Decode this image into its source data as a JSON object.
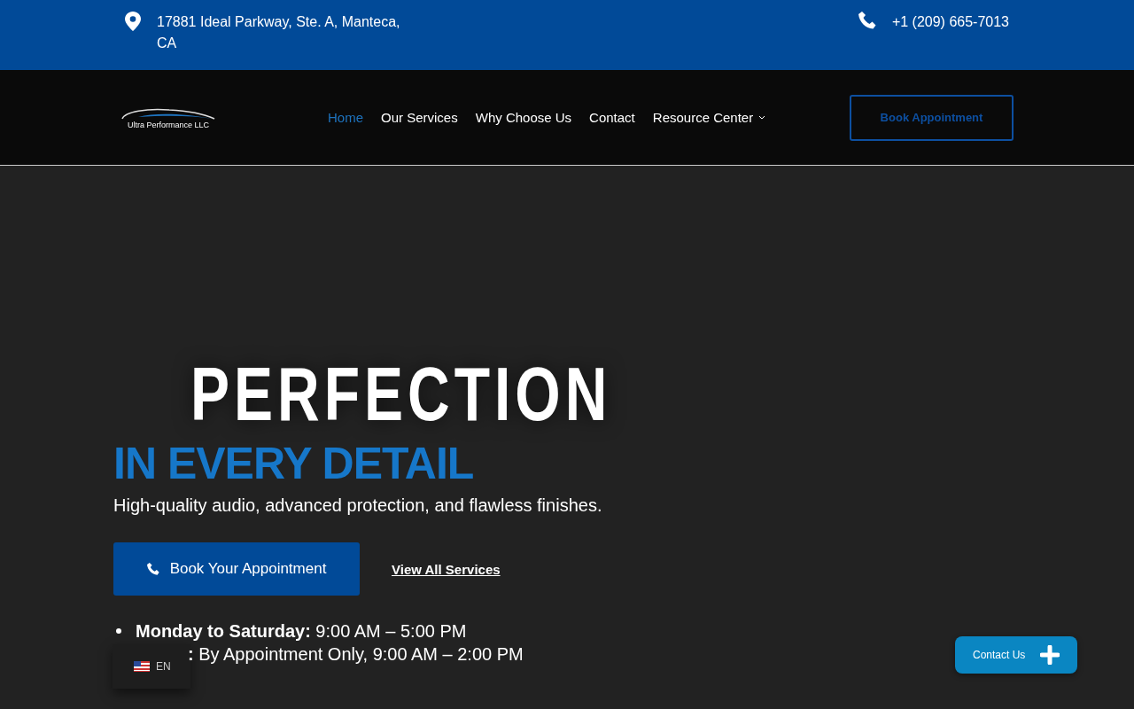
{
  "top_bar": {
    "address": "17881 Ideal Parkway, Ste. A, Manteca, CA",
    "phone": "+1 (209) 665-7013"
  },
  "header": {
    "logo_text": "Ultra Performance LLC",
    "nav": [
      {
        "label": "Home",
        "selected": true,
        "dropdown": false
      },
      {
        "label": "Our Services",
        "selected": false,
        "dropdown": false
      },
      {
        "label": "Why Choose Us",
        "selected": false,
        "dropdown": false
      },
      {
        "label": "Contact",
        "selected": false,
        "dropdown": false
      },
      {
        "label": "Resource Center",
        "selected": false,
        "dropdown": true
      }
    ],
    "cta": "Book Appointment"
  },
  "hero": {
    "title": "PERFECTION",
    "subtitle": "IN EVERY DETAIL",
    "tagline": "High-quality audio, advanced protection, and flawless finishes.",
    "primary_button": "Book Your Appointment",
    "secondary_link": "View All Services",
    "hours": [
      "**Monday to Saturday:** 9:00 AM – 5:00 PM",
      "**:** By Appointment Only, 9:00 AM – 2:00 PM"
    ]
  },
  "language": {
    "code": "EN"
  },
  "contact_widget": {
    "label": "Contact Us"
  }
}
